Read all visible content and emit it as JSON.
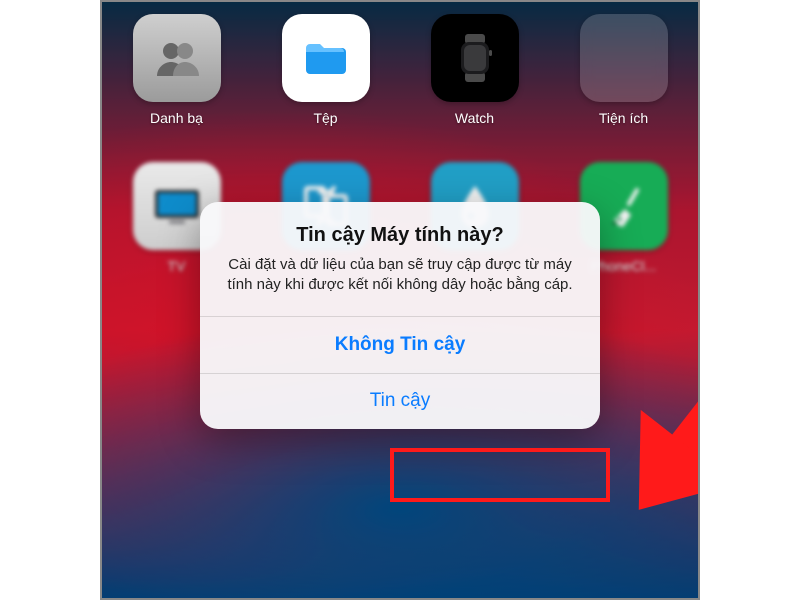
{
  "apps": {
    "row1": [
      {
        "label": "Danh bạ",
        "name": "contacts"
      },
      {
        "label": "Tệp",
        "name": "files"
      },
      {
        "label": "Watch",
        "name": "watch"
      },
      {
        "label": "Tiện ích",
        "name": "utilities-folder"
      }
    ],
    "row2": [
      {
        "label": "TV",
        "name": "tv"
      },
      {
        "label": "",
        "name": "transfer"
      },
      {
        "label": "",
        "name": "water"
      },
      {
        "label": "PhoneCl...",
        "name": "phone-clean"
      }
    ]
  },
  "dialog": {
    "title": "Tin cậy Máy tính này?",
    "message": "Cài đặt và dữ liệu của bạn sẽ truy cập được từ máy tính này khi được kết nối không dây hoặc bằng cáp.",
    "dont_trust": "Không Tin cậy",
    "trust": "Tin cậy"
  },
  "annotation": {
    "arrow_color": "#ff1a1a",
    "highlight_target": "trust-button"
  }
}
